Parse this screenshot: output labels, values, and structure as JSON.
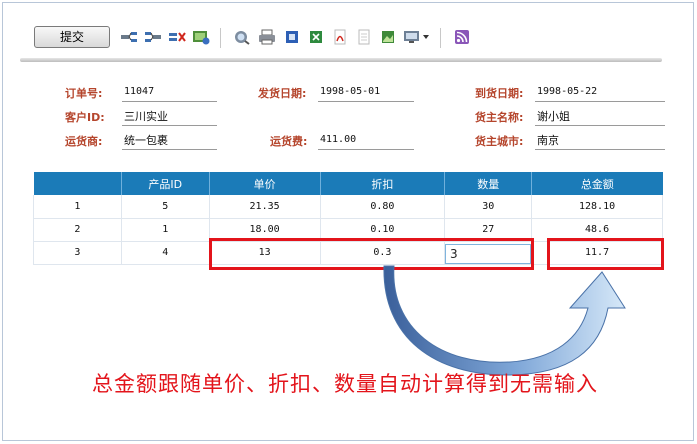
{
  "toolbar": {
    "submit_label": "提交",
    "icons": [
      "add-row-icon",
      "insert-row-icon",
      "delete-row-icon",
      "image-icon",
      "preview-icon",
      "print-icon",
      "word-export-icon",
      "excel-export-icon",
      "pdf-export-icon",
      "text-export-icon",
      "picture-export-icon",
      "email-export-icon",
      "rss-icon"
    ]
  },
  "form": {
    "order_no": {
      "label": "订单号:",
      "value": "11047"
    },
    "ship_date": {
      "label": "发货日期:",
      "value": "1998-05-01"
    },
    "arrive_date": {
      "label": "到货日期:",
      "value": "1998-05-22"
    },
    "customer_id": {
      "label": "客户ID:",
      "value": "三川实业"
    },
    "owner_name": {
      "label": "货主名称:",
      "value": "谢小姐"
    },
    "shipper": {
      "label": "运货商:",
      "value": "统一包裹"
    },
    "freight": {
      "label": "运货费:",
      "value": "411.00"
    },
    "owner_city": {
      "label": "货主城市:",
      "value": "南京"
    }
  },
  "table": {
    "headers": [
      "",
      "产品ID",
      "单价",
      "折扣",
      "数量",
      "总金额"
    ],
    "rows": [
      [
        "1",
        "5",
        "21.35",
        "0.80",
        "30",
        "128.10"
      ],
      [
        "2",
        "1",
        "18.00",
        "0.10",
        "27",
        "48.6"
      ],
      [
        "3",
        "4",
        "13",
        "0.3",
        "",
        "11.7"
      ]
    ],
    "qty_input_value": "3"
  },
  "annotation": {
    "caption": "总金额跟随单价、折扣、数量自动计算得到无需输入",
    "highlight_color": "#e3141b"
  },
  "colors": {
    "header_bg": "#1b7bb8",
    "label": "#b5452c"
  }
}
